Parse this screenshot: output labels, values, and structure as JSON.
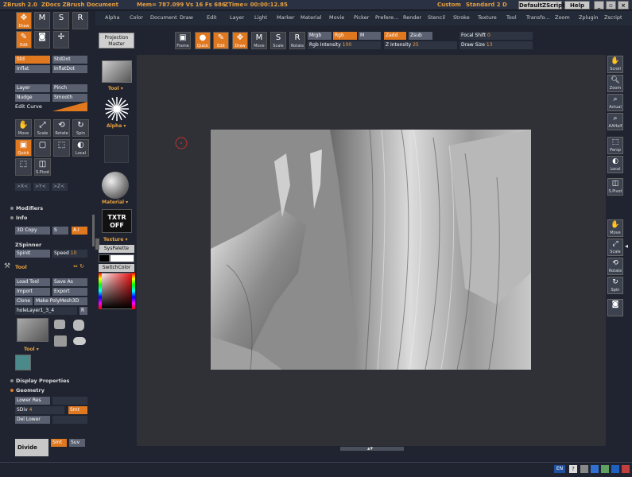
{
  "titlebar": {
    "app": "ZBrush 2.0",
    "doc": "ZDocs ZBrush Document",
    "stats": "Mem= 787.099  Vs 16  Fs 686",
    "time": "ZTime= 00:00:12.85",
    "layout_label": "Custom",
    "layout_value": "Standard 2 D",
    "script_btn": "DefaultZScript",
    "help_btn": "Help"
  },
  "menu": [
    "Alpha",
    "Color",
    "Document",
    "Draw",
    "Edit",
    "Layer",
    "Light",
    "Marker",
    "Material",
    "Movie",
    "Picker",
    "Prefere...",
    "Render",
    "Stencil",
    "Stroke",
    "Texture",
    "Tool",
    "Transfo...",
    "Zoom",
    "Zplugin",
    "Zscript"
  ],
  "top_tools": {
    "projection_master": "Projection Master",
    "frame": "Frame",
    "quick": "Quick",
    "edit": "Edit",
    "draw": "Draw",
    "move": "Move",
    "scale": "Scale",
    "rotate": "Rotate"
  },
  "top_fields": {
    "mrgb": "Mrgb",
    "rgb": "Rgb",
    "m": "M",
    "zadd": "Zadd",
    "zsub": "Zsub",
    "rgb_intensity_label": "Rgb  Intensity",
    "rgb_intensity_value": "100",
    "z_intensity_label": "Z  Intensity",
    "z_intensity_value": "25",
    "focal_shift_label": "Focal  Shift",
    "focal_shift_value": "0",
    "draw_size_label": "Draw  Size",
    "draw_size_value": "13"
  },
  "left_top": {
    "draw": "Draw",
    "edit": "Edit"
  },
  "strokes": [
    "Std",
    "StdDot",
    "Inflat",
    "InflatDot",
    "Layer",
    "Pinch",
    "Nudge",
    "Smooth"
  ],
  "edit_curve": "Edit Curve",
  "transform_tools": [
    "Move",
    "Scale",
    "Rotate",
    "Spin",
    "Quick",
    "",
    "",
    "Local",
    "",
    "S.Pivot"
  ],
  "axis": [
    ">X<",
    ">Y<",
    ">Z<"
  ],
  "sections": {
    "modifiers": "Modifiers",
    "info": "Info",
    "copy3d": "3D Copy",
    "s": "S",
    "ai": "A.I",
    "zspinner": "ZSpinner",
    "spinit": "SpinIt",
    "speed_label": "Speed",
    "speed_value": "10",
    "tool": "Tool",
    "load_tool": "Load Tool",
    "save_as": "Save As",
    "import": "Import",
    "export": "Export",
    "clone": "Clone",
    "make_polymesh": "Make PolyMesh3D",
    "hole_layer": "holeLayer1_3_4",
    "r": "R",
    "tool_label": "Tool",
    "display_properties": "Display Properties",
    "geometry": "Geometry",
    "lower_res": "Lower Res",
    "sdiv_label": "SDiv",
    "sdiv_value": "4",
    "smt": "Smt",
    "del_lower": "Del Lower",
    "divide": "Divide",
    "smt2": "Smt",
    "suv": "Suv"
  },
  "palette": {
    "tool": "Tool",
    "alpha": "Alpha",
    "material": "Material",
    "texture_off": "TXTR OFF",
    "texture": "Texture",
    "syspalette": "SysPalette",
    "switchcolor": "SwitchColor"
  },
  "right_tools": [
    "Scroll",
    "Zoom",
    "Actual",
    "AAHalf",
    "Persp",
    "Local",
    "S.Pivot",
    "Move",
    "Scale",
    "Rotate",
    "Spin",
    ""
  ],
  "taskbar": {
    "lang": "EN"
  },
  "colors": {
    "accent": "#e07820",
    "canvas": "#2f3136",
    "panel": "#1f2430"
  }
}
